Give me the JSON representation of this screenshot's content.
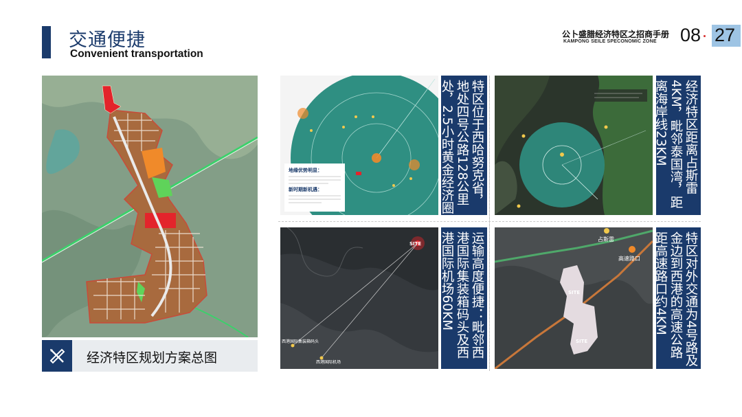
{
  "header": {
    "title_cn": "交通便捷",
    "title_en": "Convenient transportation",
    "brand_cn": "公卜盛腊经济特区之招商手册",
    "brand_en": "KAMPONG SEILE SPECONOMIC ZONE",
    "page_prefix": "08",
    "page_dot": "·",
    "page_number": "27"
  },
  "left_panel": {
    "caption": "经济特区规划方案总图"
  },
  "panels": {
    "top_left_text": "特区位于西哈努克省，地处四号公路128公里处，2.5小时黄金经济圈",
    "top_right_text": "经济特区距离占斯雷4KM，毗邻泰国湾，距离海岸线23KM",
    "bottom_left_text": "运输高度便捷：毗邻西港国际集装箱码头及西港国际机场60KM",
    "bottom_right_text": "特区对外交通为4号路及金边到西港的高速公路距高速路口约4KM"
  },
  "map_labels": {
    "legend_title_1": "地缘优势明显：",
    "legend_title_2": "新时期新机遇：",
    "site": "SITE",
    "port": "西港国际集装箱码头",
    "airport": "西港国际机场",
    "zhansilei": "占斯雷",
    "highway_exit": "高速路口",
    "site_1": "SITE",
    "site_2": "SITE"
  },
  "colors": {
    "navy": "#1a3a6b",
    "page_highlight": "#9ec4e4",
    "accent_red": "#d7302f",
    "zone_brown": "#a86a3e",
    "teal_circle": "#2f8f82"
  }
}
